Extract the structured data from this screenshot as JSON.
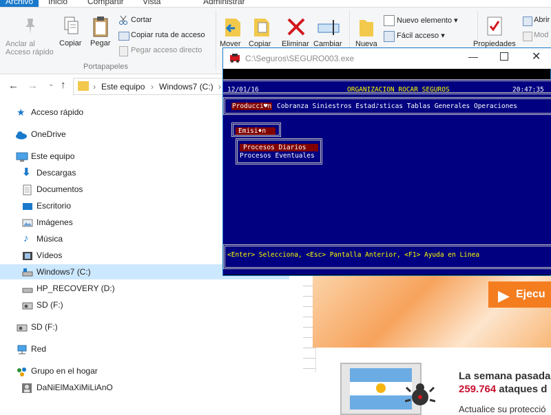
{
  "ribbon_tabs": [
    "Archivo",
    "Inicio",
    "Compartir",
    "Vista",
    "Administrar"
  ],
  "ribbon": {
    "anclar": "Anclar al",
    "anclar2": "Acceso rápido",
    "copiar": "Copiar",
    "pegar": "Pegar",
    "cortar": "Cortar",
    "copiar_ruta": "Copiar ruta de acceso",
    "pegar_acceso": "Pegar acceso directo",
    "portapapeles": "Portapapeles",
    "mover": "Mover",
    "copiar_a": "Copiar",
    "eliminar": "Eliminar",
    "cambiar": "Cambiar",
    "nueva": "Nueva",
    "nuevo_elemento": "Nuevo elemento",
    "facil_acceso": "Fácil acceso",
    "propiedades": "Propiedades",
    "abrir": "Abrir",
    "mod": "Mod"
  },
  "address": {
    "crumbs": [
      "Este equipo",
      "Windows7 (C:)"
    ]
  },
  "nav": [
    {
      "label": "Acceso rápido",
      "icon": "star-icon"
    },
    {
      "label": "OneDrive",
      "icon": "cloud-icon"
    },
    {
      "label": "Este equipo",
      "icon": "computer-icon"
    },
    {
      "label": "Descargas",
      "icon": "download-icon"
    },
    {
      "label": "Documentos",
      "icon": "document-icon"
    },
    {
      "label": "Escritorio",
      "icon": "desktop-icon"
    },
    {
      "label": "Imágenes",
      "icon": "pictures-icon"
    },
    {
      "label": "Música",
      "icon": "music-icon"
    },
    {
      "label": "Vídeos",
      "icon": "video-icon"
    },
    {
      "label": "Windows7 (C:)",
      "icon": "drive-icon"
    },
    {
      "label": "HP_RECOVERY (D:)",
      "icon": "drive-icon"
    },
    {
      "label": "SD (F:)",
      "icon": "sd-drive-icon"
    },
    {
      "label": "SD (F:)",
      "icon": "sd-drive-icon"
    },
    {
      "label": "Red",
      "icon": "network-icon"
    },
    {
      "label": "Grupo en el hogar",
      "icon": "homegroup-icon"
    },
    {
      "label": "DaNiElMaXiMiLiAnO",
      "icon": "user-icon"
    }
  ],
  "console": {
    "title": "C:\\Seguros\\SEGURO003.exe",
    "date": "12/01/16",
    "org": "ORGANIZACION ROCAR SEGUROS",
    "time": "20:47:35",
    "menu_first": "Producci♥n",
    "menu_rest": "Cobranza Siniestros Estad♪sticas Tablas Generales Operaciones",
    "submenu": "Emisi♦n",
    "proc_1": "Procesos Diarios",
    "proc_2": "Procesos Eventuales",
    "status": "<Enter> Selecciona, <Esc> Pantalla Anterior, <F1> Ayuda en Linea"
  },
  "web": {
    "button": "Ejecu",
    "headline_1": "La semana pasada",
    "headline_num": "259.764",
    "headline_2": "ataques d",
    "sub": "Actualice su protecció"
  },
  "colors": {
    "console_bg": "#000080",
    "highlight": "#800000",
    "yellow": "#ffff00",
    "accent": "#1979ca",
    "orange": "#f47d20"
  }
}
